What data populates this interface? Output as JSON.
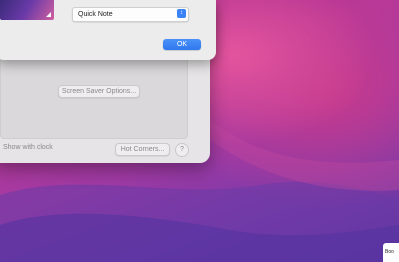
{
  "dialog": {
    "select_value": "Quick Note",
    "ok_label": "OK"
  },
  "screensaver": {
    "options_label": "Screen Saver Options...",
    "show_clock_label": "Show with clock",
    "hot_corners_label": "Hot Corners...",
    "help_label": "?"
  },
  "desktop": {
    "corner_tag": "Boo"
  },
  "colors": {
    "accent": "#3b82f6",
    "wallpaper_pink": "#e3549d",
    "wallpaper_purple": "#6a3aa8"
  }
}
